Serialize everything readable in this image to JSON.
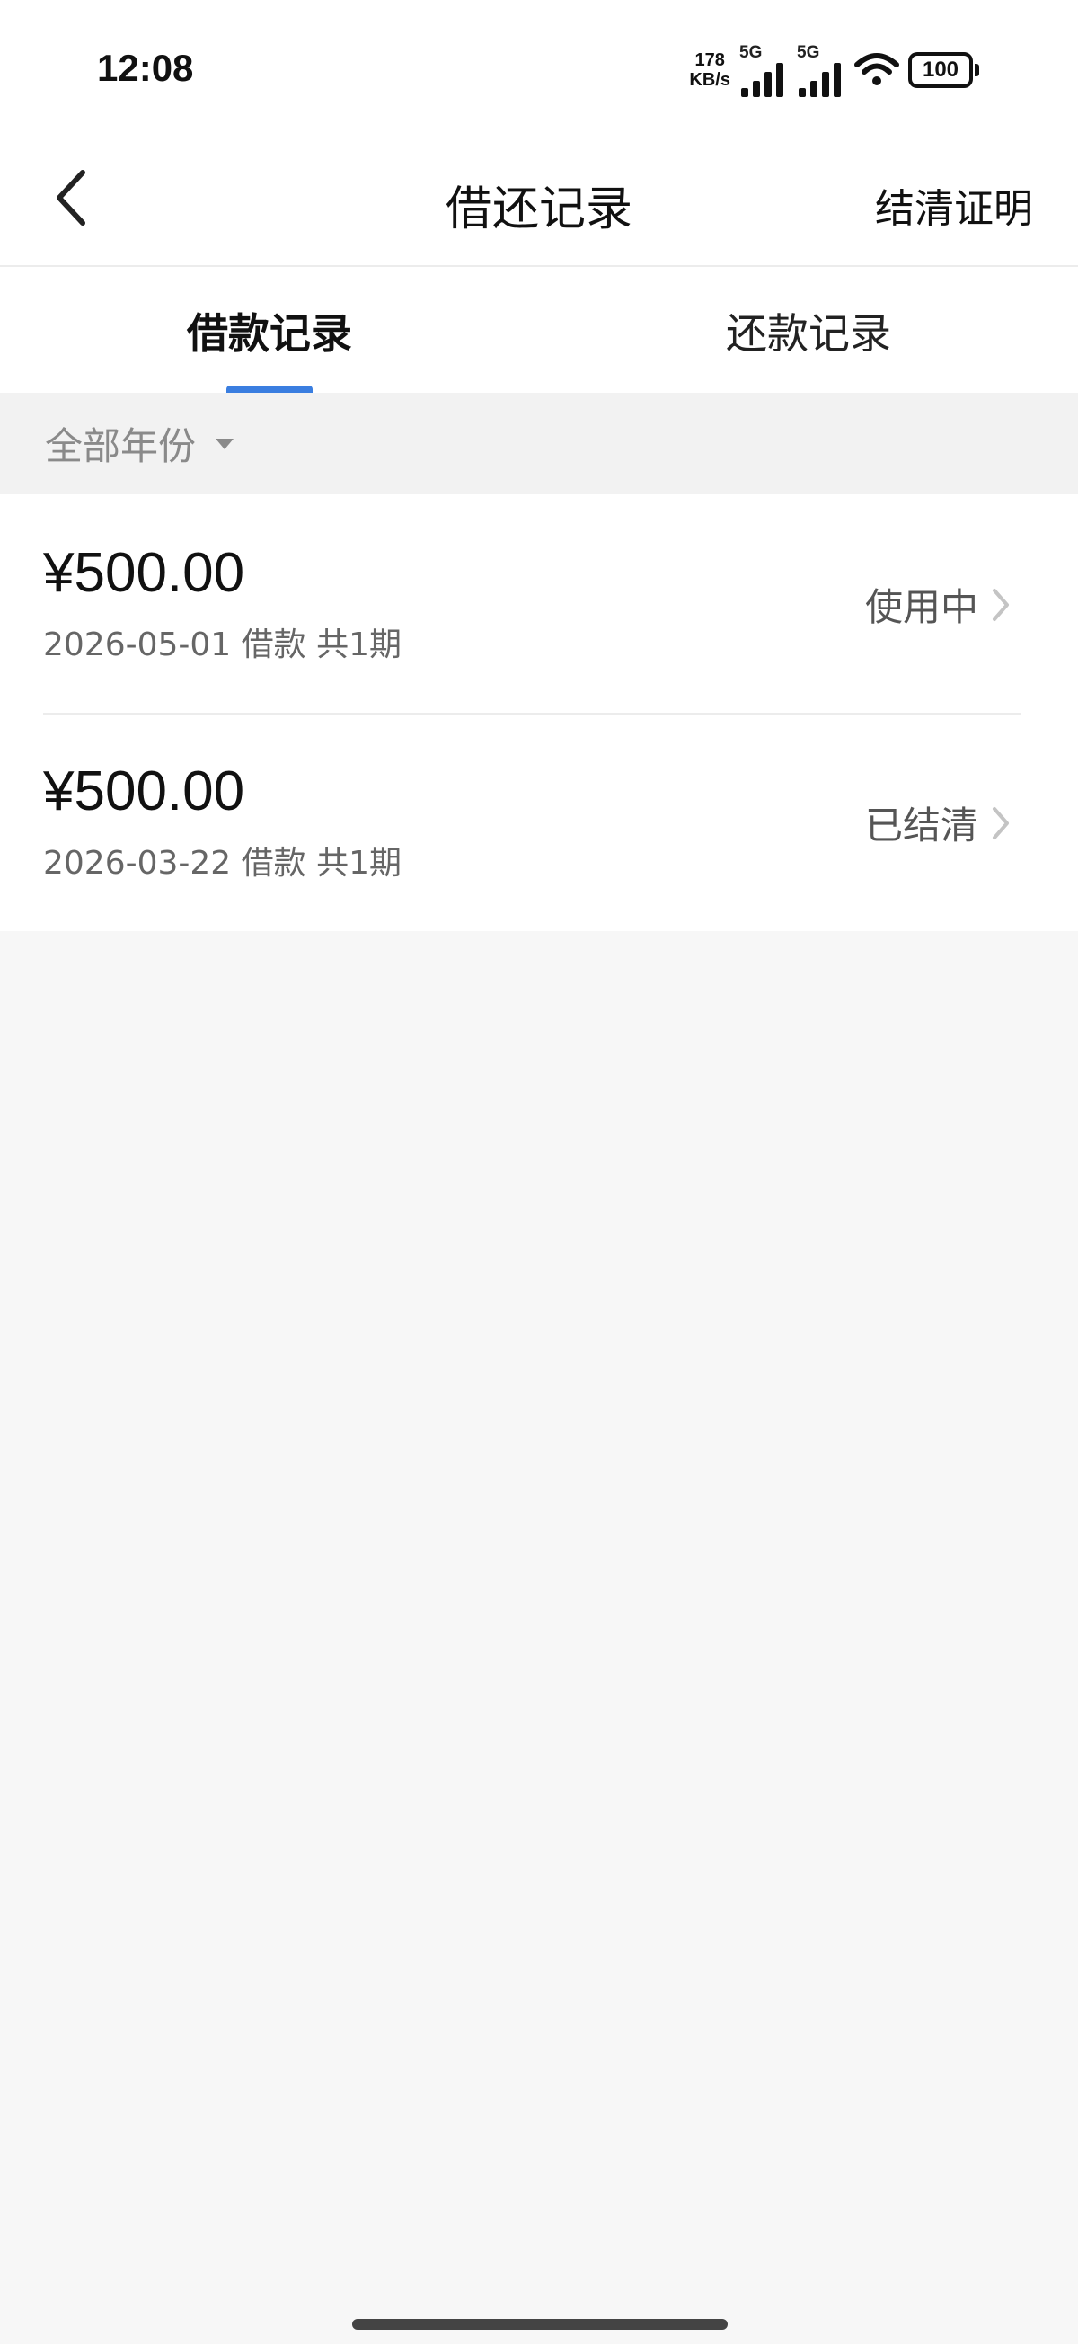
{
  "status_bar": {
    "time": "12:08",
    "net_speed_value": "178",
    "net_speed_unit": "KB/s",
    "sim1_label": "5G",
    "sim2_label": "5G",
    "battery": "100"
  },
  "header": {
    "back_icon": "chevron-left-icon",
    "title": "借还记录",
    "action_label": "结清证明"
  },
  "tabs": [
    {
      "label": "借款记录",
      "active": true
    },
    {
      "label": "还款记录",
      "active": false
    }
  ],
  "filter": {
    "label": "全部年份",
    "icon": "caret-down-icon"
  },
  "loans": [
    {
      "amount": "¥500.00",
      "meta": "2026-05-01 借款 共1期",
      "status": "使用中"
    },
    {
      "amount": "¥500.00",
      "meta": "2026-03-22 借款 共1期",
      "status": "已结清"
    }
  ],
  "colors": {
    "accent": "#3a7ee0",
    "background": "#f7f7f7",
    "card": "#ffffff"
  }
}
